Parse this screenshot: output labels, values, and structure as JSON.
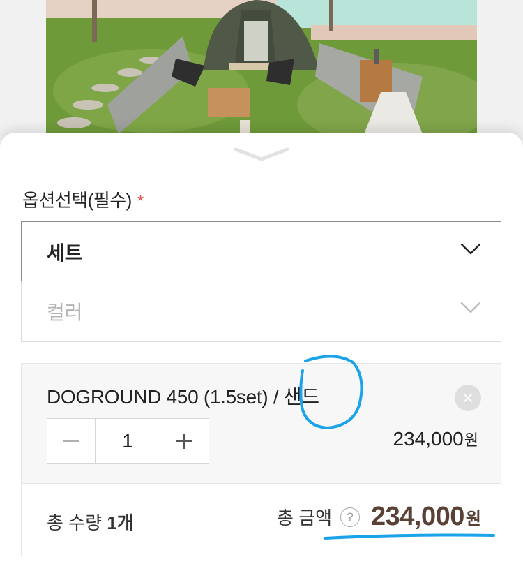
{
  "option_section": {
    "title": "옵션선택(필수)",
    "required_mark": "*",
    "set_select": {
      "value": "세트"
    },
    "color_select": {
      "placeholder": "컬러"
    }
  },
  "selected_item": {
    "name": "DOGROUND 450 (1.5set) / 샌드",
    "quantity": "1",
    "price": "234,000",
    "currency": "원",
    "minus_symbol": "−",
    "plus_symbol": "+"
  },
  "totals": {
    "quantity_label": "총 수량 ",
    "quantity_value": "1개",
    "amount_label": "총 금액",
    "help_symbol": "?",
    "amount_value": "234,000",
    "currency": "원"
  },
  "icons": {
    "sheet_handle": "chevron-down-icon",
    "dropdown": "chevron-down-icon",
    "remove": "close-icon",
    "help": "question-circle-icon"
  },
  "colors": {
    "accent_price": "#5a4136",
    "required_star": "#e0443c",
    "annotation": "#1aa3e8"
  }
}
